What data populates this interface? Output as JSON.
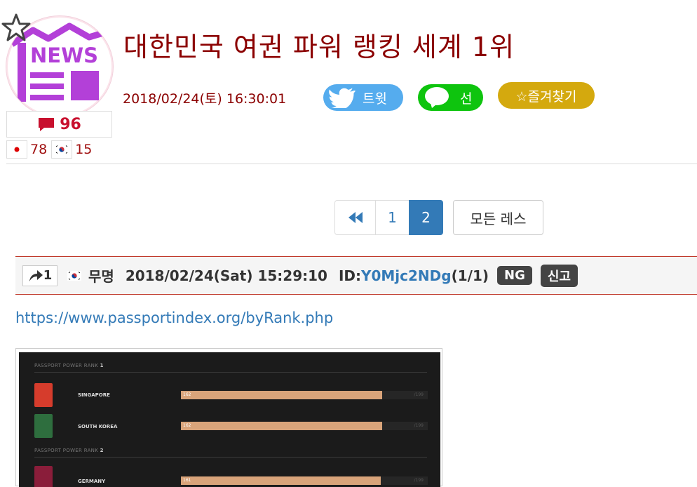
{
  "article": {
    "logo_text": "NEWS",
    "title": "대한민국 여권 파워 랭킹 세계 1위",
    "date": "2018/02/24(토) 16:30:01",
    "comment_count": "96",
    "jp_count": "78",
    "kr_count": "15"
  },
  "share": {
    "tweet_label": "트윗",
    "line_label": "선",
    "favorite_label": "☆즐겨찾기"
  },
  "pagination": {
    "pages": [
      "1",
      "2"
    ],
    "current": "2",
    "all_label": "모든 레스"
  },
  "post": {
    "reply_count": "1",
    "name": "무명",
    "datetime": "2018/02/24(Sat) 15:29:10",
    "id_label": "ID:",
    "id_value": "Y0Mjc2NDg",
    "id_suffix": "(1/1)",
    "ng_label": "NG",
    "report_label": "신고",
    "link": "https://www.passportindex.org/byRank.php"
  },
  "embedded_image": {
    "rank1_label": "PASSPORT POWER RANK",
    "rank1_num": "1",
    "rank2_label": "PASSPORT POWER RANK",
    "rank2_num": "2",
    "rows": [
      {
        "country": "SINGAPORE",
        "score": 162,
        "max": "/199",
        "color": "#d63c2c"
      },
      {
        "country": "SOUTH KOREA",
        "score": 162,
        "max": "/199",
        "color": "#2e6e3e"
      },
      {
        "country": "GERMANY",
        "score": 161,
        "max": "/199",
        "color": "#8a1d3a"
      }
    ]
  },
  "colors": {
    "title": "#8b0000",
    "twitter": "#55acee",
    "line": "#0ec40e",
    "favorite": "#d4a90e",
    "link": "#337ab7"
  }
}
